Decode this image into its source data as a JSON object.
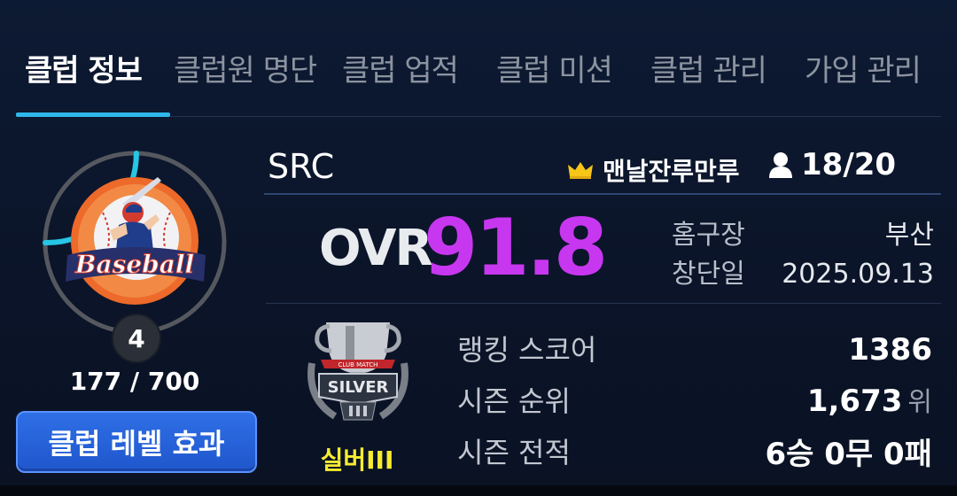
{
  "tabs": [
    {
      "label": "클럽 정보",
      "active": true
    },
    {
      "label": "클럽원 명단",
      "active": false
    },
    {
      "label": "클럽 업적",
      "active": false
    },
    {
      "label": "클럽 미션",
      "active": false
    },
    {
      "label": "클럽 관리",
      "active": false
    },
    {
      "label": "가입 관리",
      "active": false
    }
  ],
  "emblem": {
    "text": "Baseball",
    "icon": "baseball-batter-emblem"
  },
  "level": {
    "value": "4",
    "exp": "177 / 700",
    "progress": 0.253
  },
  "level_button_label": "클럽 레벨 효과",
  "club": {
    "name": "SRC",
    "leader": "맨날잔루만루",
    "members": "18/20"
  },
  "ovr": {
    "label": "OVR",
    "value": "91.8"
  },
  "info": {
    "home_label": "홈구장",
    "home_value": "부산",
    "founded_label": "창단일",
    "founded_value": "2025.09.13"
  },
  "tier": {
    "name": "실버III",
    "badge_text": "SILVER",
    "badge_top_text": "CLUB MATCH"
  },
  "stats": {
    "ranking_label": "랭킹 스코어",
    "ranking_value": "1386",
    "season_rank_label": "시즌 순위",
    "season_rank_value": "1,673",
    "season_rank_unit": "위",
    "season_record_label": "시즌 전적",
    "season_record_value": "6승 0무 0패"
  },
  "colors": {
    "accent": "#2fb7ea",
    "ovr": "#c837f0",
    "tier": "#f6ec31",
    "button": "#2663d8",
    "background": "#0c1529"
  }
}
